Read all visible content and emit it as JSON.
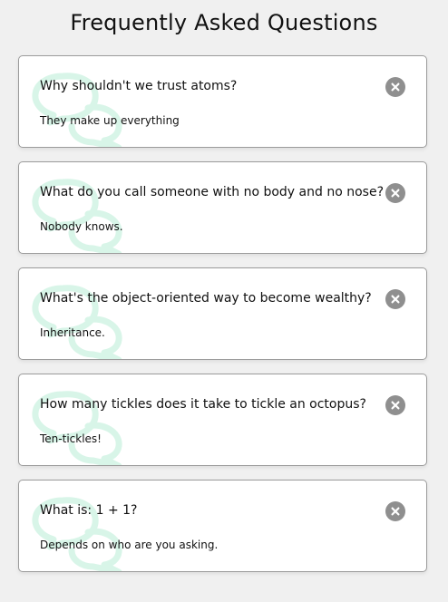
{
  "page": {
    "title": "Frequently Asked Questions"
  },
  "faqs": [
    {
      "question": "Why shouldn't we trust atoms?",
      "answer": "They make up everything"
    },
    {
      "question": "What do you call someone with no body and no nose?",
      "answer": "Nobody knows."
    },
    {
      "question": "What's the object-oriented way to become wealthy?",
      "answer": "Inheritance."
    },
    {
      "question": "How many tickles does it take to tickle an octopus?",
      "answer": "Ten-tickles!"
    },
    {
      "question": "What is: 1 + 1?",
      "answer": "Depends on who are you asking."
    }
  ],
  "icons": {
    "bubble": "chat-bubbles-icon",
    "close": "close-icon"
  },
  "colors": {
    "background": "#f0f0f0",
    "card": "#ffffff",
    "bubble": "#d8f5e8",
    "close": "#8f8f8f"
  }
}
